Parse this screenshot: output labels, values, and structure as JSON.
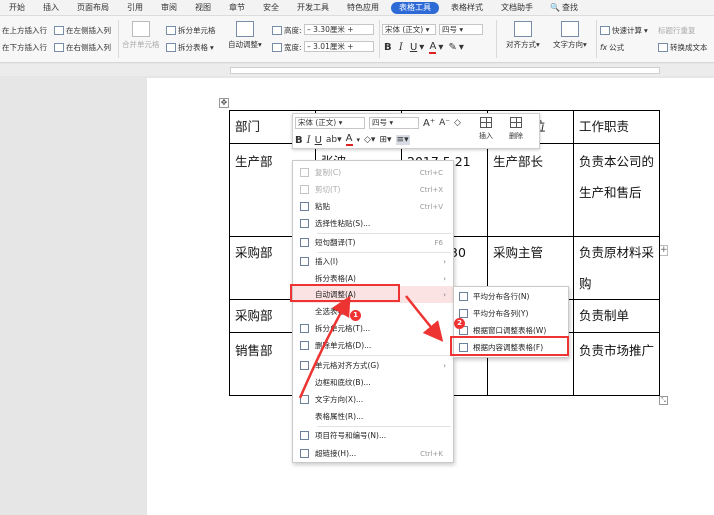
{
  "menubar": {
    "tabs": [
      {
        "label": "开始"
      },
      {
        "label": "插入"
      },
      {
        "label": "页面布局"
      },
      {
        "label": "引用"
      },
      {
        "label": "审阅"
      },
      {
        "label": "视图"
      },
      {
        "label": "章节"
      },
      {
        "label": "安全"
      },
      {
        "label": "开发工具"
      },
      {
        "label": "特色应用"
      },
      {
        "label": "表格工具"
      },
      {
        "label": "表格样式"
      },
      {
        "label": "文档助手"
      }
    ],
    "active_tab": "表格工具",
    "search_label": "查找"
  },
  "ribbon": {
    "insert_above": "在上方插入行",
    "insert_left": "在左侧插入列",
    "insert_below": "在下方插入行",
    "insert_right": "在右侧插入列",
    "merge_cells": "合并单元格",
    "split_cells": "拆分单元格",
    "split_table": "拆分表格",
    "auto_fit": "自动调整",
    "height_label": "高度:",
    "height_value": "3.30厘米",
    "width_label": "宽度:",
    "width_value": "3.01厘米",
    "font_name": "宋体 (正文)",
    "font_size": "四号",
    "align": "对齐方式",
    "text_direction": "文字方向",
    "quick_calc": "快速计算",
    "title_repeat": "标题行重复",
    "formula": "公式",
    "convert_text": "转换成文本"
  },
  "table": {
    "rows": [
      [
        "部门",
        "",
        "",
        "位",
        "工作职责"
      ],
      [
        "生产部",
        "张波",
        "2017.5.21",
        "生产部长",
        "负责本公司的生产和售后"
      ],
      [
        "采购部",
        "",
        "30",
        "采购主管",
        "负责原材料采购"
      ],
      [
        "采购部",
        "",
        "",
        "",
        "负责制单"
      ],
      [
        "销售部",
        "",
        "",
        "",
        "负责市场推广"
      ]
    ]
  },
  "mini_toolbar": {
    "font_name": "宋体 (正文)",
    "font_size": "四号",
    "insert_label": "插入",
    "delete_label": "删除"
  },
  "context_menu": {
    "items": [
      {
        "label": "复制(C)",
        "shortcut": "Ctrl+C",
        "disabled": true
      },
      {
        "label": "剪切(T)",
        "shortcut": "Ctrl+X",
        "disabled": true
      },
      {
        "label": "粘贴",
        "shortcut": "Ctrl+V",
        "disabled": false
      },
      {
        "label": "选择性粘贴(S)...",
        "shortcut": "",
        "disabled": false
      },
      {
        "label": "短句翻译(T)",
        "shortcut": "F6",
        "disabled": false
      },
      {
        "label": "插入(I)",
        "shortcut": "",
        "disabled": false
      },
      {
        "label": "拆分表格(A)",
        "shortcut": "",
        "disabled": false
      },
      {
        "label": "自动调整(A)",
        "shortcut": "",
        "disabled": false
      },
      {
        "label": "全选表格",
        "shortcut": "",
        "disabled": false
      },
      {
        "label": "拆分单元格(T)...",
        "shortcut": "",
        "disabled": false
      },
      {
        "label": "删除单元格(D)...",
        "shortcut": "",
        "disabled": false
      },
      {
        "label": "单元格对齐方式(G)",
        "shortcut": "",
        "disabled": false
      },
      {
        "label": "边框和底纹(B)...",
        "shortcut": "",
        "disabled": false
      },
      {
        "label": "文字方向(X)...",
        "shortcut": "",
        "disabled": false
      },
      {
        "label": "表格属性(R)...",
        "shortcut": "",
        "disabled": false
      },
      {
        "label": "项目符号和编号(N)...",
        "shortcut": "",
        "disabled": false
      },
      {
        "label": "超链接(H)...",
        "shortcut": "Ctrl+K",
        "disabled": false
      }
    ]
  },
  "submenu": {
    "items": [
      {
        "label": "平均分布各行(N)"
      },
      {
        "label": "平均分布各列(Y)"
      },
      {
        "label": "根据窗口调整表格(W)"
      },
      {
        "label": "根据内容调整表格(F)"
      }
    ]
  },
  "annotations": {
    "badge1": "1",
    "badge2": "2",
    "highlight_color": "#e33333"
  }
}
